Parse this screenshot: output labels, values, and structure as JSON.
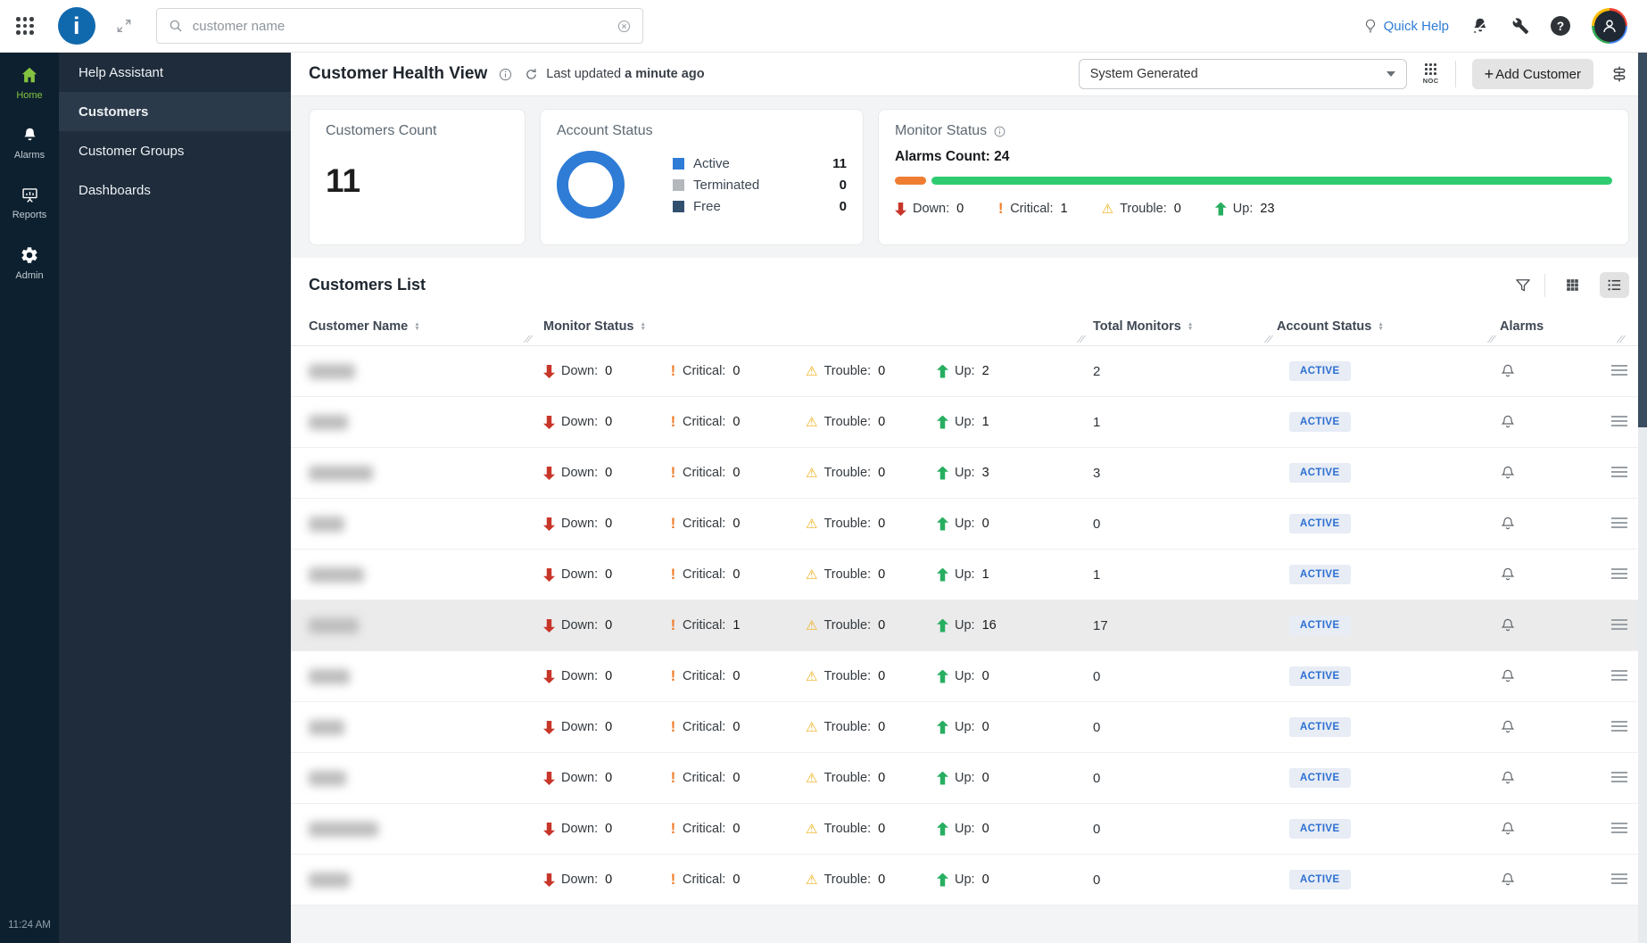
{
  "icons": {
    "critical_glyph": "!",
    "trouble_glyph": "⚠",
    "help_glyph": "?",
    "logo_glyph": "i"
  },
  "topbar": {
    "search_placeholder": "customer name",
    "quick_help": "Quick Help"
  },
  "rail": {
    "items": [
      {
        "label": "Home"
      },
      {
        "label": "Alarms"
      },
      {
        "label": "Reports"
      },
      {
        "label": "Admin"
      }
    ],
    "time": "11:24 AM"
  },
  "sidebar": {
    "items": [
      {
        "label": "Help Assistant"
      },
      {
        "label": "Customers"
      },
      {
        "label": "Customer Groups"
      },
      {
        "label": "Dashboards"
      }
    ],
    "selected": "Customers"
  },
  "header": {
    "title": "Customer Health View",
    "last_updated_prefix": "Last updated",
    "last_updated_value": "a minute ago",
    "view_select_value": "System Generated",
    "noc_label": "NOC",
    "add_customer_label": "Add Customer",
    "add_customer_plus": "+"
  },
  "cards": {
    "customers_count": {
      "title": "Customers Count",
      "value": "11"
    },
    "account_status": {
      "title": "Account Status",
      "donut_color": "#2e7cd6",
      "legend": [
        {
          "label": "Active",
          "value": "11",
          "color": "#2e7cd6"
        },
        {
          "label": "Terminated",
          "value": "0",
          "color": "#b4b8bc"
        },
        {
          "label": "Free",
          "value": "0",
          "color": "#31506e"
        }
      ]
    },
    "monitor_status": {
      "title": "Monitor Status",
      "alarms_count_label": "Alarms Count:",
      "alarms_count_value": "24",
      "bar_segments": [
        {
          "color": "#ee7d32",
          "pct": 4.4
        },
        {
          "color": "#2fcb71",
          "pct": 94.8
        }
      ],
      "stats": [
        {
          "type": "down",
          "label": "Down:",
          "value": "0"
        },
        {
          "type": "critical",
          "label": "Critical:",
          "value": "1"
        },
        {
          "type": "trouble",
          "label": "Trouble:",
          "value": "0"
        },
        {
          "type": "up",
          "label": "Up:",
          "value": "23"
        }
      ]
    }
  },
  "list": {
    "title": "Customers List",
    "columns": [
      {
        "label": "Customer Name",
        "sortable": true
      },
      {
        "label": "Monitor Status",
        "sortable": true
      },
      {
        "label": "Total Monitors",
        "sortable": true
      },
      {
        "label": "Account Status",
        "sortable": true
      },
      {
        "label": "Alarms",
        "sortable": false
      }
    ],
    "stat_labels": {
      "down": "Down:",
      "critical": "Critical:",
      "trouble": "Trouble:",
      "up": "Up:"
    },
    "rows": [
      {
        "blob_w": 52,
        "down": "0",
        "critical": "0",
        "trouble": "0",
        "up": "2",
        "total": "2",
        "status": "ACTIVE",
        "highlighted": false
      },
      {
        "blob_w": 44,
        "down": "0",
        "critical": "0",
        "trouble": "0",
        "up": "1",
        "total": "1",
        "status": "ACTIVE",
        "highlighted": false
      },
      {
        "blob_w": 72,
        "down": "0",
        "critical": "0",
        "trouble": "0",
        "up": "3",
        "total": "3",
        "status": "ACTIVE",
        "highlighted": false
      },
      {
        "blob_w": 40,
        "down": "0",
        "critical": "0",
        "trouble": "0",
        "up": "0",
        "total": "0",
        "status": "ACTIVE",
        "highlighted": false
      },
      {
        "blob_w": 62,
        "down": "0",
        "critical": "0",
        "trouble": "0",
        "up": "1",
        "total": "1",
        "status": "ACTIVE",
        "highlighted": false
      },
      {
        "blob_w": 56,
        "down": "0",
        "critical": "1",
        "trouble": "0",
        "up": "16",
        "total": "17",
        "status": "ACTIVE",
        "highlighted": true
      },
      {
        "blob_w": 46,
        "down": "0",
        "critical": "0",
        "trouble": "0",
        "up": "0",
        "total": "0",
        "status": "ACTIVE",
        "highlighted": false
      },
      {
        "blob_w": 40,
        "down": "0",
        "critical": "0",
        "trouble": "0",
        "up": "0",
        "total": "0",
        "status": "ACTIVE",
        "highlighted": false
      },
      {
        "blob_w": 42,
        "down": "0",
        "critical": "0",
        "trouble": "0",
        "up": "0",
        "total": "0",
        "status": "ACTIVE",
        "highlighted": false
      },
      {
        "blob_w": 78,
        "down": "0",
        "critical": "0",
        "trouble": "0",
        "up": "0",
        "total": "0",
        "status": "ACTIVE",
        "highlighted": false
      },
      {
        "blob_w": 46,
        "down": "0",
        "critical": "0",
        "trouble": "0",
        "up": "0",
        "total": "0",
        "status": "ACTIVE",
        "highlighted": false
      }
    ]
  },
  "chart_data": {
    "type": "pie",
    "title": "Account Status",
    "categories": [
      "Active",
      "Terminated",
      "Free"
    ],
    "values": [
      11,
      0,
      0
    ],
    "colors": [
      "#2e7cd6",
      "#b4b8bc",
      "#31506e"
    ],
    "legend_position": "right"
  }
}
